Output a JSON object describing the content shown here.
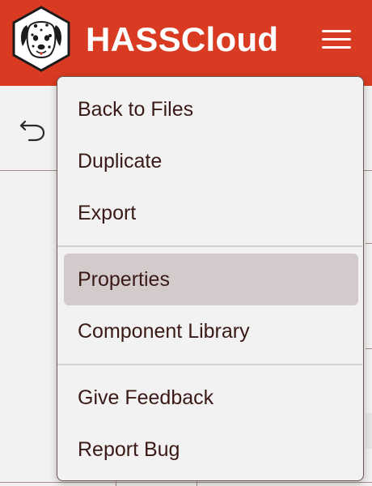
{
  "header": {
    "title": "HASSCloud",
    "logo_icon": "dalmatian-logo-icon",
    "menu_icon": "hamburger-menu-icon",
    "background_color": "#d83b22"
  },
  "toolbar": {
    "undo_icon": "undo-arrow-icon"
  },
  "menu": {
    "groups": [
      {
        "items": [
          {
            "label": "Back to Files",
            "active": false
          },
          {
            "label": "Duplicate",
            "active": false
          },
          {
            "label": "Export",
            "active": false
          }
        ]
      },
      {
        "items": [
          {
            "label": "Properties",
            "active": true
          },
          {
            "label": "Component Library",
            "active": false
          }
        ]
      },
      {
        "items": [
          {
            "label": "Give Feedback",
            "active": false
          },
          {
            "label": "Report Bug",
            "active": false
          }
        ]
      }
    ],
    "highlight_color": "#d3cacc"
  }
}
